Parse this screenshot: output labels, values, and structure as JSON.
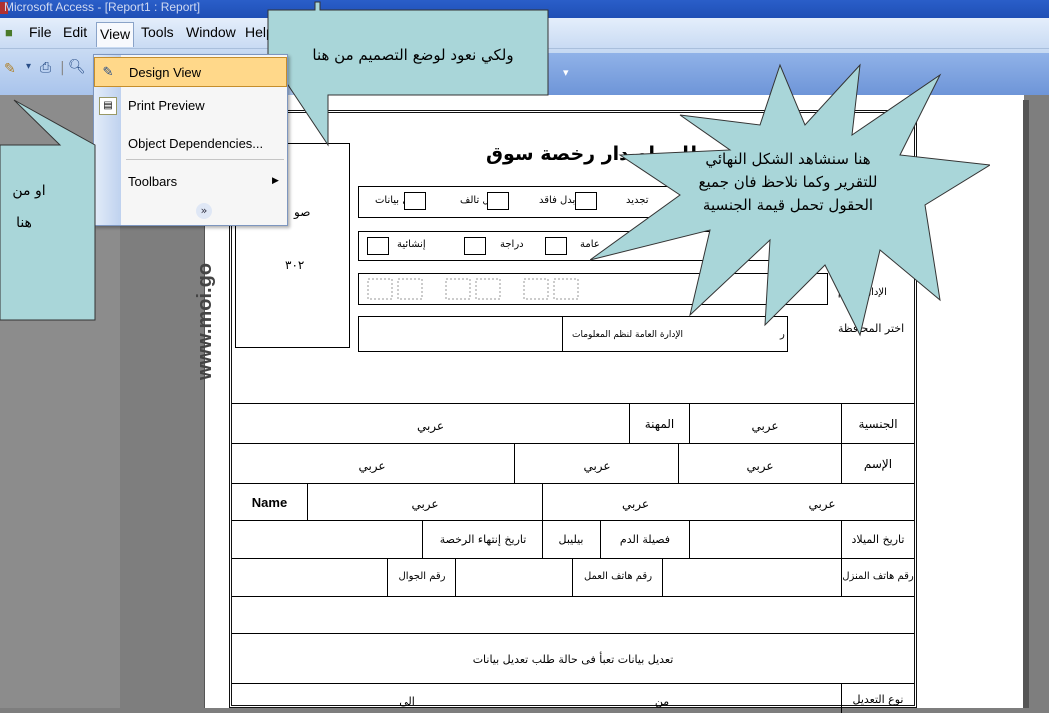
{
  "window": {
    "title": "Microsoft Access - [Report1 : Report]"
  },
  "menubar": {
    "items": [
      "File",
      "Edit",
      "View",
      "Tools",
      "Window",
      "Help"
    ]
  },
  "dropdown": {
    "items": [
      "Design View",
      "Print Preview",
      "Object Dependencies...",
      "Toolbars"
    ]
  },
  "callouts": {
    "top": "ولكي نعود لوضع التصميم من هنا",
    "left_line1": "او من",
    "left_line2": "هنا",
    "star": "هنا سنشاهد الشكل النهائي للتقرير وكما نلاحظ فان جميع الحقول تحمل قيمة الجنسية"
  },
  "report": {
    "side_url": "www.moi.go",
    "title": "طلب إصدار رخصة سوق",
    "photo_label_partial": "صو",
    "photo_code": "٣٠٢",
    "options_row1": [
      "تعديل بيانات",
      "بدل تالف",
      "بدل فاقد",
      "تجديد"
    ],
    "options_row2": [
      "إنشائية",
      "دراجة",
      "عامة"
    ],
    "left_labels": [
      "الإدارة العام",
      "اختر المحافظة"
    ],
    "info_box": "الإدارة العامة لنظم المعلومات",
    "info_box_left": "ر",
    "rows": {
      "nationality_label": "الجنسية",
      "nationality_value": "عربي",
      "profession_label": "المهنة",
      "profession_value": "عربي",
      "name_label": "الإسم",
      "name_values": [
        "عربي",
        "عربي",
        "عربي"
      ],
      "name_en_label": "Name",
      "name_en_values": [
        "عربي",
        "عربي",
        "عربي"
      ],
      "dob_label": "تاريخ الميلاد",
      "blood_label": "فصيلة الدم",
      "blood_value": "بيليبل",
      "expiry_label": "تاريخ إنتهاء الرخصة",
      "home_phone_label": "رقم هاتف المنزل",
      "work_phone_label": "رقم هاتف العمل",
      "mobile_label": "رقم الجوال",
      "edit_note": "تعديل بيانات تعبأ فى حالة طلب تعديل بيانات",
      "edit_type_label": "نوع التعديل",
      "from_label": "من",
      "to_label": "الى"
    }
  }
}
